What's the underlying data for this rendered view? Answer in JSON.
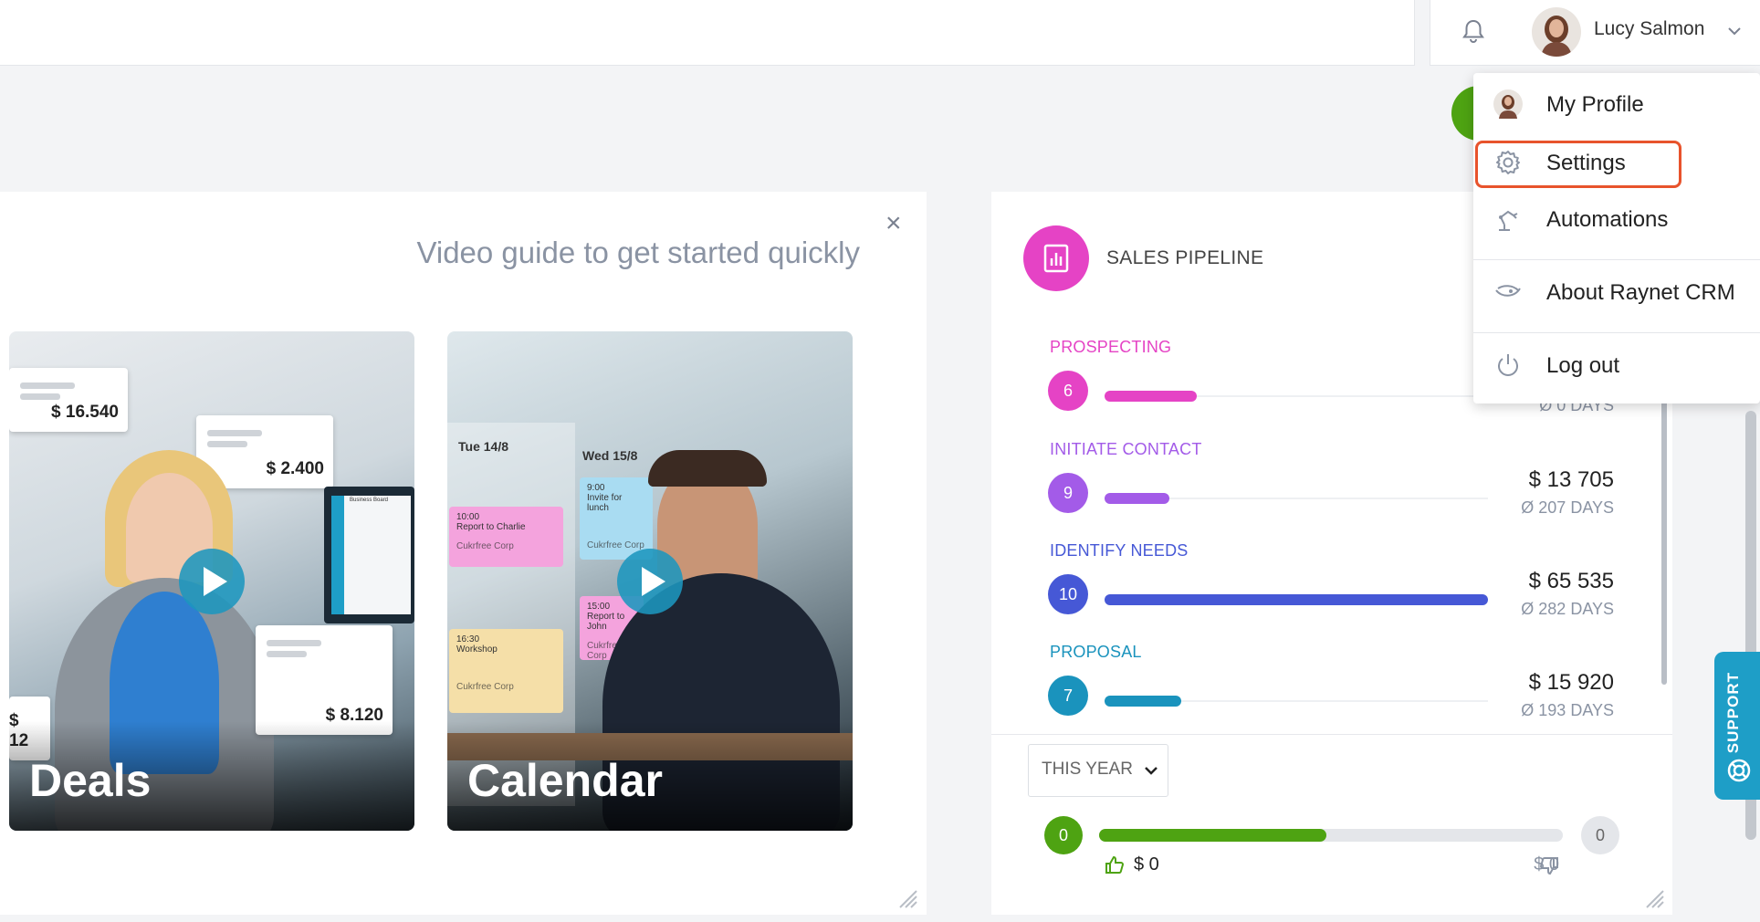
{
  "header": {
    "user_name": "Lucy Salmon"
  },
  "menu": {
    "items": [
      {
        "label": "My Profile",
        "icon": "avatar-icon"
      },
      {
        "label": "Settings",
        "icon": "gear-icon"
      },
      {
        "label": "Automations",
        "icon": "robot-arm-icon"
      },
      {
        "label": "About Raynet CRM",
        "icon": "raynet-logo-icon"
      },
      {
        "label": "Log out",
        "icon": "power-icon"
      }
    ],
    "highlight_color": "#e8532c"
  },
  "video_guide": {
    "title": "Video guide to get started quickly",
    "close": "×",
    "tiles": [
      {
        "label": "Deals",
        "amounts": [
          "$ 16.540",
          "$ 2.400",
          "$ 8.120",
          "$ 12"
        ],
        "screen_title": "Business Board"
      },
      {
        "label": "Calendar",
        "dates": [
          "Tue 14/8",
          "Wed 15/8"
        ],
        "notes": [
          {
            "time": "10:00",
            "text": "Report to Charlie",
            "company": "Cukrfree Corp"
          },
          {
            "time": "9:00",
            "text": "Invite for lunch",
            "company": "Cukrfree Corp"
          },
          {
            "time": "16:30",
            "text": "Workshop",
            "company": "Cukrfree Corp"
          },
          {
            "time": "15:00",
            "text": "Report to John",
            "company": "Cukrfree Corp"
          }
        ]
      }
    ]
  },
  "pipeline": {
    "title": "SALES PIPELINE",
    "stages": [
      {
        "name": "PROSPECTING",
        "count": "6",
        "color": "#e543c5",
        "fill": 0.24,
        "amount": "",
        "days": "Ø 0 DAYS"
      },
      {
        "name": "INITIATE CONTACT",
        "count": "9",
        "color": "#a35be8",
        "fill": 0.17,
        "amount": "$ 13 705",
        "days": "Ø 207 DAYS"
      },
      {
        "name": "IDENTIFY NEEDS",
        "count": "10",
        "color": "#4658d6",
        "fill": 1.0,
        "amount": "$ 65 535",
        "days": "Ø 282 DAYS"
      },
      {
        "name": "PROPOSAL",
        "count": "7",
        "color": "#1a93bd",
        "fill": 0.2,
        "amount": "$ 15 920",
        "days": "Ø 193 DAYS"
      }
    ],
    "period": "THIS YEAR",
    "won_count": "0",
    "lost_count": "0",
    "won_amount": "$ 0",
    "lost_amount": "$ 0",
    "won_fill": 0.49
  },
  "support": {
    "label": "SUPPORT"
  }
}
